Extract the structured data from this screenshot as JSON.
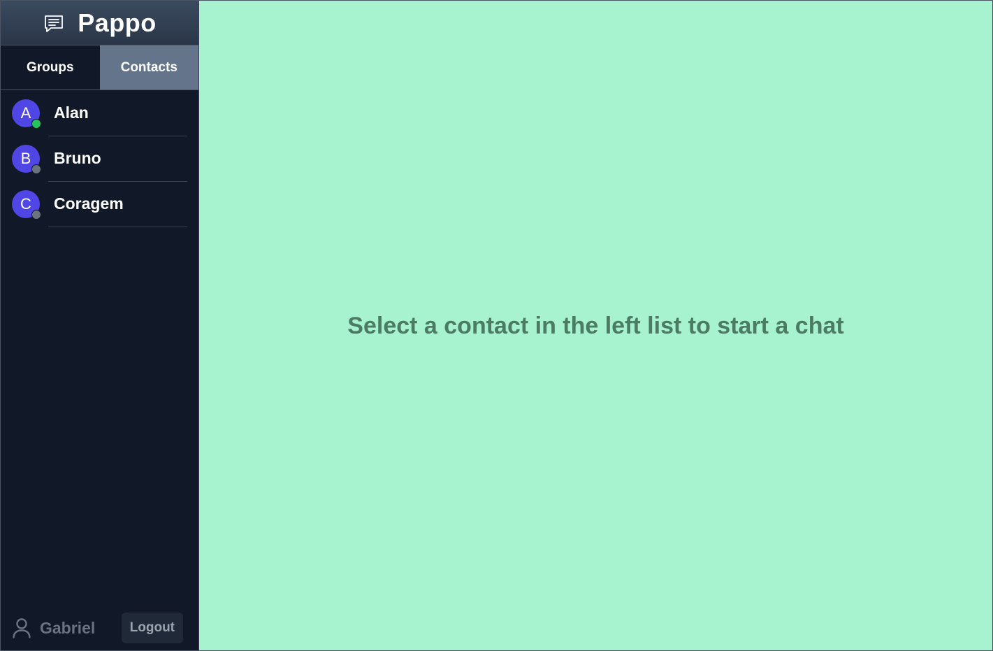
{
  "app": {
    "title": "Pappo",
    "icon": "chat-bubble-icon"
  },
  "tabs": [
    {
      "label": "Groups",
      "active": false
    },
    {
      "label": "Contacts",
      "active": true
    }
  ],
  "contacts": [
    {
      "initial": "A",
      "name": "Alan",
      "status": "online",
      "status_color": "#22c55e"
    },
    {
      "initial": "B",
      "name": "Bruno",
      "status": "offline",
      "status_color": "#6b7280"
    },
    {
      "initial": "C",
      "name": "Coragem",
      "status": "offline",
      "status_color": "#6b7280"
    }
  ],
  "footer": {
    "user_icon": "user-icon",
    "user_name": "Gabriel",
    "logout_label": "Logout"
  },
  "main": {
    "placeholder": "Select a contact in the left list to start a chat"
  },
  "colors": {
    "sidebar_bg": "#111827",
    "active_tab": "#64748b",
    "avatar": "#4f46e5",
    "main_bg": "#a7f3d0",
    "placeholder_text": "#4b7b63"
  }
}
